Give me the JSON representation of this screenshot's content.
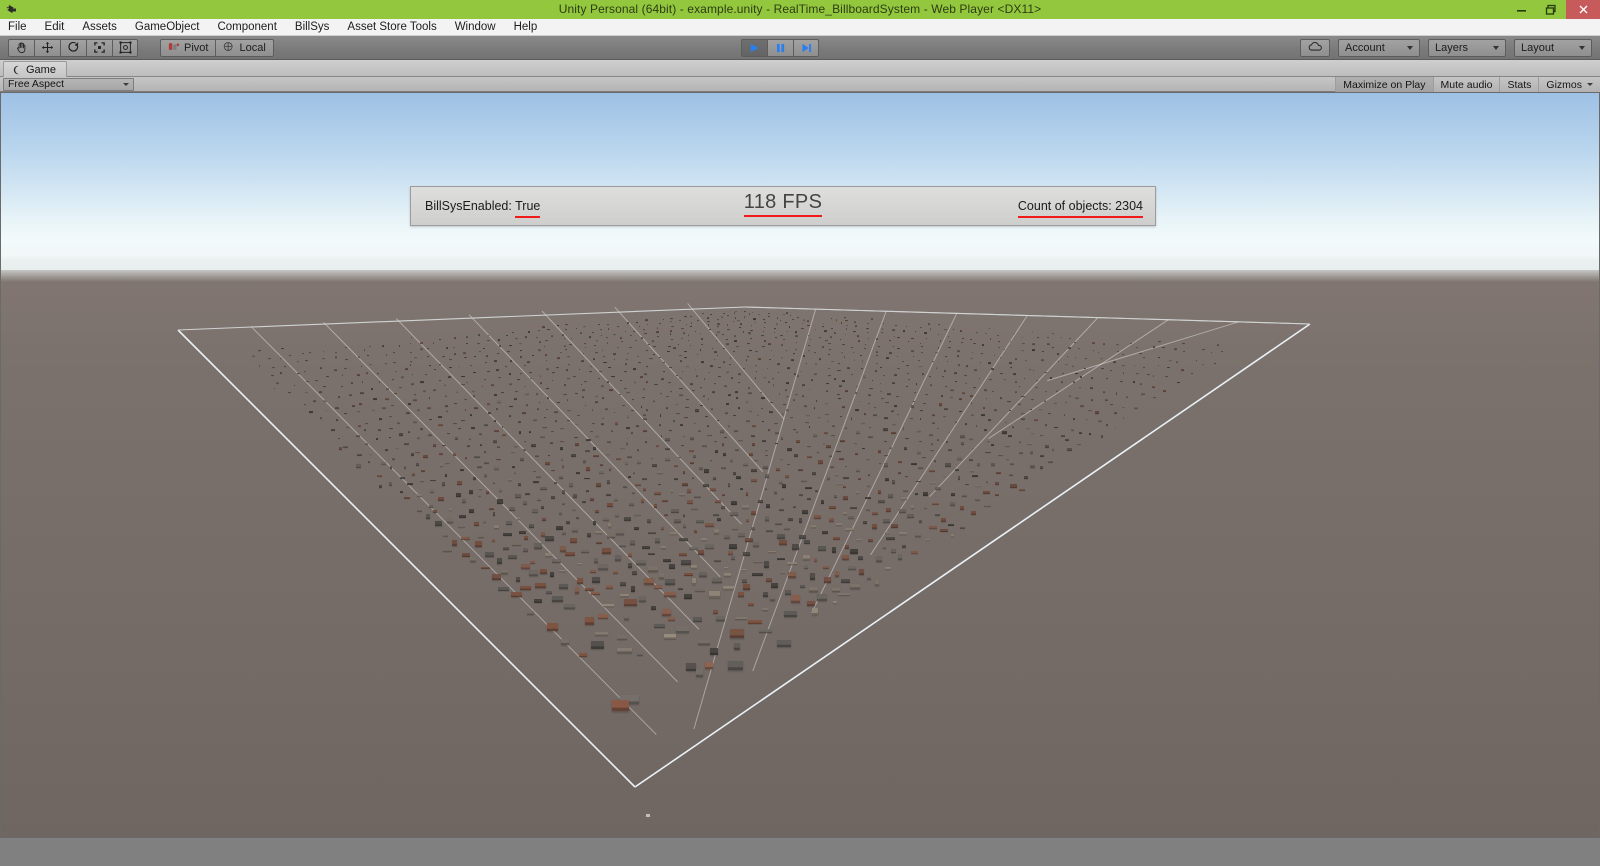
{
  "window": {
    "title": "Unity Personal (64bit) - example.unity - RealTime_BillboardSystem - Web Player <DX11>",
    "logo_icon": "unity-logo-icon",
    "minimize_icon": "minimize-icon",
    "restore_icon": "restore-icon",
    "close_icon": "close-icon"
  },
  "menubar": {
    "items": [
      {
        "label": "File"
      },
      {
        "label": "Edit"
      },
      {
        "label": "Assets"
      },
      {
        "label": "GameObject"
      },
      {
        "label": "Component"
      },
      {
        "label": "BillSys"
      },
      {
        "label": "Asset Store Tools"
      },
      {
        "label": "Window"
      },
      {
        "label": "Help"
      }
    ]
  },
  "toolbar": {
    "transform_tools": [
      {
        "name": "hand-tool",
        "icon": "hand-icon"
      },
      {
        "name": "move-tool",
        "icon": "move-arrows-icon"
      },
      {
        "name": "rotate-tool",
        "icon": "rotate-icon"
      },
      {
        "name": "scale-tool",
        "icon": "scale-icon"
      },
      {
        "name": "rect-tool",
        "icon": "rect-transform-icon"
      }
    ],
    "pivot_label": "Pivot",
    "pivot_icon": "pivot-icon",
    "local_label": "Local",
    "local_icon": "local-rotation-icon",
    "play_label": "Play",
    "play_icon": "play-icon",
    "pause_label": "Pause",
    "pause_icon": "pause-icon",
    "step_label": "Step",
    "step_icon": "step-forward-icon",
    "cloud_icon": "cloud-icon",
    "account_label": "Account",
    "layers_label": "Layers",
    "layout_label": "Layout"
  },
  "gameview": {
    "tab_label": "Game",
    "tab_icon": "game-view-icon",
    "aspect_label": "Free Aspect",
    "maximize_label": "Maximize on Play",
    "mute_label": "Mute audio",
    "stats_label": "Stats",
    "gizmos_label": "Gizmos"
  },
  "overlay": {
    "billsys_prefix": "BillSysEnabled: ",
    "billsys_value": "True",
    "fps_text": "118 FPS",
    "count_text": "Count of objects: 2304",
    "underline_color": "#f21b1b"
  },
  "scene": {
    "sky_top_color": "#9dc0e4",
    "sky_horizon_color": "#f3fafb",
    "ground_color": "#7a706c",
    "plane_color": "#a9a6a4",
    "grid_line_color": "#ffffff",
    "building_palette": [
      "#8c5e4c",
      "#6d6a66",
      "#9a8f83",
      "#5e5a56",
      "#a3705a",
      "#7f7a74",
      "#b3a694",
      "#4e4b47",
      "#96604a",
      "#888179"
    ]
  }
}
